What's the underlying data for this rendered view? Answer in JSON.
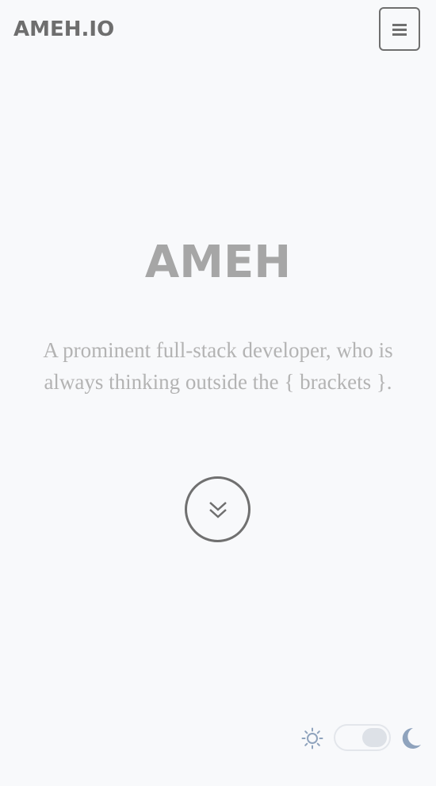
{
  "header": {
    "brand": "AMEH.IO",
    "menu_button": {
      "icon": "hamburger-menu-icon"
    }
  },
  "hero": {
    "title": "AMEH",
    "subtitle": "A prominent full-stack developer, who is always thinking outside the { brackets }.",
    "scroll_button": {
      "icon": "double-chevron-down-icon"
    }
  },
  "theme_switch": {
    "light_icon": "sun-icon",
    "dark_icon": "moon-icon",
    "state": "off"
  },
  "colors": {
    "background": "#f8f9fb",
    "brand_text": "#6e6e6e",
    "title_text": "#a6a6a6",
    "subtitle_text": "#b3b3b3",
    "icon_blue": "#8fa3bd"
  }
}
